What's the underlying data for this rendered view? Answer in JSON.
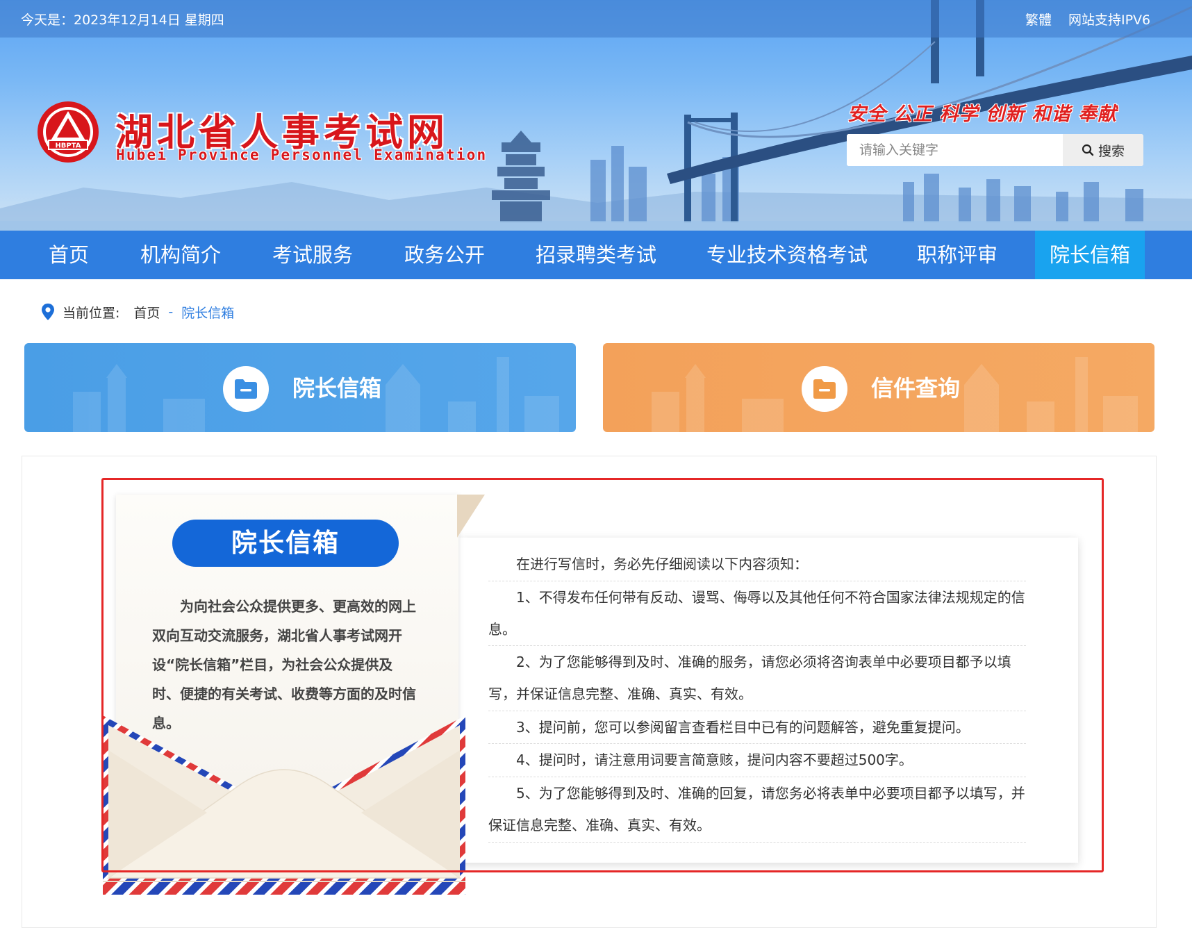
{
  "topbar": {
    "date": "今天是：2023年12月14日 星期四",
    "traditional": "繁體",
    "ipv6": "网站支持IPV6"
  },
  "header": {
    "logo_text": "HBPTA",
    "title": "湖北省人事考试网",
    "subtitle": "Hubei Province Personnel Examination",
    "slogan": "安全 公正 科学 创新 和谐 奉献",
    "search_placeholder": "请输入关键字",
    "search_button": "搜索"
  },
  "nav": [
    {
      "label": "首页"
    },
    {
      "label": "机构简介"
    },
    {
      "label": "考试服务"
    },
    {
      "label": "政务公开"
    },
    {
      "label": "招录聘类考试"
    },
    {
      "label": "专业技术资格考试"
    },
    {
      "label": "职称评审"
    },
    {
      "label": "院长信箱"
    }
  ],
  "breadcrumb": {
    "prefix": "当前位置:",
    "home": "首页",
    "separator": "-",
    "current": "院长信箱"
  },
  "features": {
    "mailbox": "院长信箱",
    "query": "信件查询"
  },
  "letter": {
    "badge": "院长信箱",
    "intro": "为向社会公众提供更多、更高效的网上双向互动交流服务，湖北省人事考试网开设“院长信箱”栏目，为社会公众提供及时、便捷的有关考试、收费等方面的及时信息。"
  },
  "notice": {
    "heading": "在进行写信时，务必先仔细阅读以下内容须知：",
    "items": [
      "1、不得发布任何带有反动、谩骂、侮辱以及其他任何不符合国家法律法规规定的信息。",
      "2、为了您能够得到及时、准确的服务，请您必须将咨询表单中必要项目都予以填写，并保证信息完整、准确、真实、有效。",
      "3、提问前，您可以参阅留言查看栏目中已有的问题解答，避免重复提问。",
      "4、提问时，请注意用词要言简意赅，提问内容不要超过500字。",
      "5、为了您能够得到及时、准确的回复，请您务必将表单中必要项目都予以填写，并保证信息完整、准确、真实、有效。"
    ]
  },
  "colors": {
    "nav_bg": "#2f7ee0",
    "nav_active": "#19a3ef",
    "brand_red": "#d8161b",
    "badge_blue": "#1467d8",
    "feature_blue": "#4a9ee6",
    "feature_orange": "#f3a15a",
    "highlight_red": "#e52727"
  },
  "icons": {
    "logo": "hbpta-triangle-logo",
    "search": "search-icon",
    "location": "location-pin-icon",
    "folder": "folder-icon",
    "envelope": "airmail-envelope-illustration"
  }
}
